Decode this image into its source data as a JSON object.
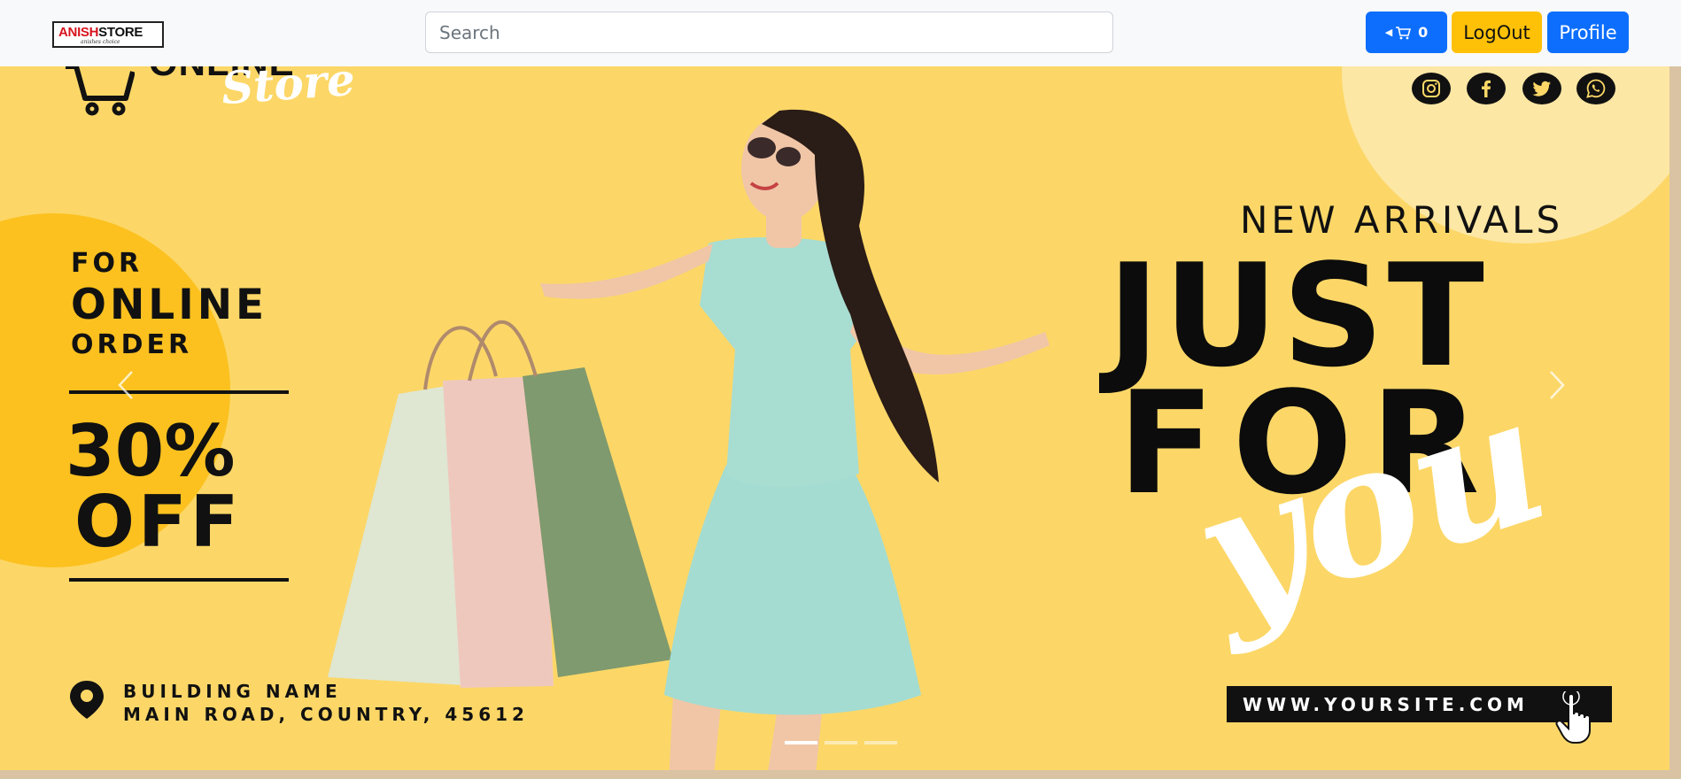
{
  "navbar": {
    "brand": {
      "part1": "ANISH",
      "part2": "STORE",
      "tagline": "anishes choice"
    },
    "search": {
      "placeholder": "Search",
      "value": ""
    },
    "cart": {
      "count": "0",
      "icon": "cart-icon"
    },
    "logout_label": "LogOut",
    "profile_label": "Profile",
    "colors": {
      "primary": "#0d6efd",
      "warning": "#ffc107",
      "background": "#f8f9fa"
    }
  },
  "carousel": {
    "slide_count": 3,
    "active_index": 0,
    "prev_icon": "chevron-left-icon",
    "next_icon": "chevron-right-icon",
    "slide": {
      "logo_word": "ONLINE",
      "logo_script": "Store",
      "social_icons": [
        "instagram-icon",
        "facebook-icon",
        "twitter-icon",
        "whatsapp-icon"
      ],
      "promo": {
        "line1": "FOR",
        "line2": "ONLINE",
        "line3": "ORDER",
        "discount": "30%",
        "off": "OFF"
      },
      "headline": {
        "kicker": "NEW ARRIVALS",
        "line1": "JUST",
        "line2": "FOR",
        "script": "you"
      },
      "address": {
        "line1": "BUILDING NAME",
        "line2": "MAIN ROAD, COUNTRY, 45612"
      },
      "website": "WWW.YOURSITE.COM",
      "colors": {
        "background": "#fcd767",
        "accent_circle": "#fcc11f",
        "light_circle": "#fde7a4",
        "text": "#111111"
      }
    }
  }
}
